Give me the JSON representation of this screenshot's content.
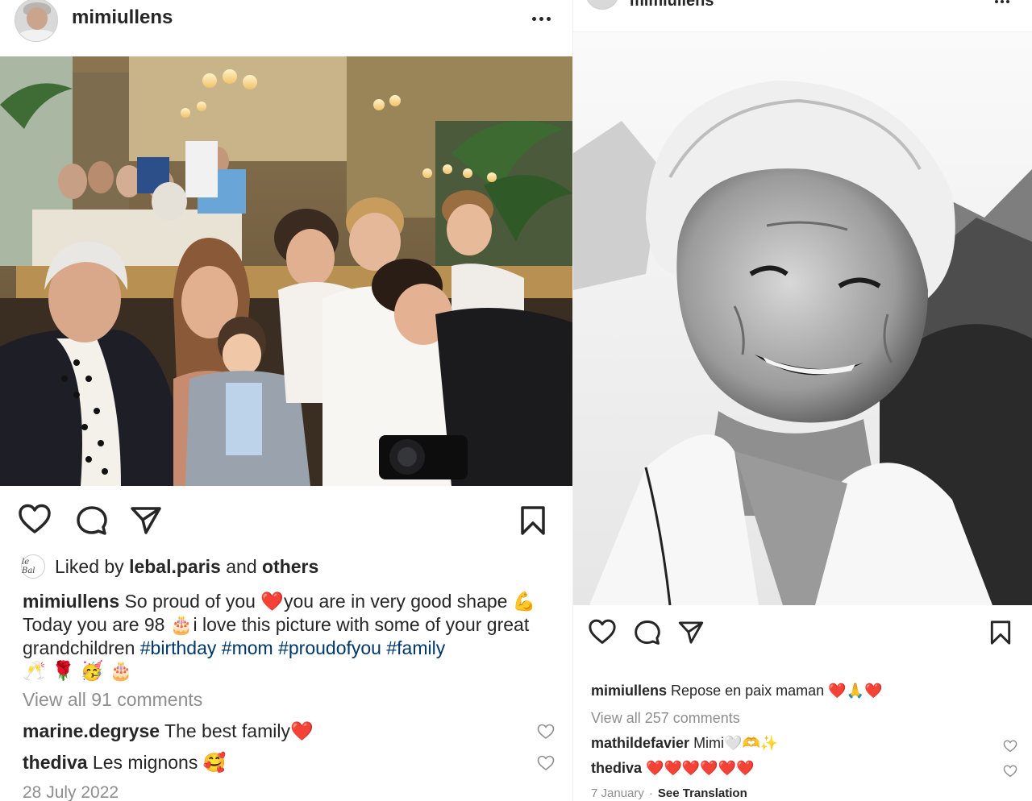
{
  "left_post": {
    "username": "mimiullens",
    "liked": {
      "avatar_text": "le Bal",
      "prefix": "Liked by",
      "user": "lebal.paris",
      "middle": "and",
      "others": "others"
    },
    "caption": {
      "username": "mimiullens",
      "text_1": "So proud of you",
      "text_2": "you are in very good shape",
      "text_3": "Today you are 98",
      "text_4": "i love this picture with some of your great grandchildren",
      "hashtags": [
        "#birthday",
        "#mom",
        "#proudofyou",
        "#family"
      ],
      "emoji_heart": "❤️",
      "emoji_muscle": "💪",
      "emoji_cake": "🎂",
      "emoji_trailing": "🥂 🌹 🥳 🎂"
    },
    "view_comments": "View all 91 comments",
    "comments": [
      {
        "username": "marine.degryse",
        "text": "The best family",
        "emoji": "❤️"
      },
      {
        "username": "thediva",
        "text": "Les mignons",
        "emoji": "🥰"
      }
    ],
    "date": "28 July 2022"
  },
  "right_post": {
    "username": "mimiullens",
    "caption": {
      "username": "mimiullens",
      "text": "Repose en paix maman",
      "emoji": "❤️🙏❤️"
    },
    "view_comments": "View all 257 comments",
    "comments": [
      {
        "username": "mathildefavier",
        "text": "Mimi",
        "emoji": "🤍🫶✨"
      },
      {
        "username": "thediva",
        "text": "",
        "emoji": "❤️❤️❤️❤️❤️❤️"
      }
    ],
    "date": "7 January",
    "separator": "·",
    "see_translation": "See Translation"
  },
  "icons": {
    "like": "heart-outline-icon",
    "comment": "speech-bubble-icon",
    "share": "paper-plane-icon",
    "save": "bookmark-outline-icon",
    "more": "more-horizontal-icon",
    "comment_like": "small-heart-icon"
  },
  "colors": {
    "text": "#262626",
    "muted": "#8e8e8e",
    "hashtag": "#00376b",
    "heart": "#ed1c24"
  }
}
